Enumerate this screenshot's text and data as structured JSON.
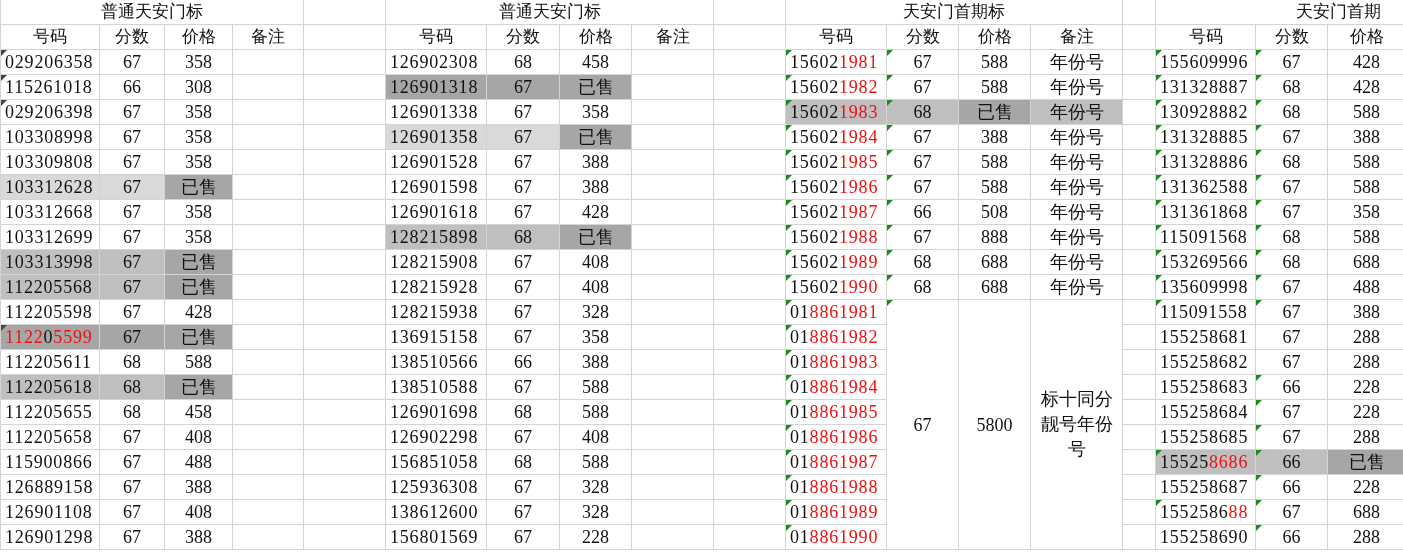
{
  "sections": [
    {
      "title": "普通天安门标",
      "columns": [
        "号码",
        "分数",
        "价格",
        "备注"
      ],
      "green_markers": false,
      "rows": [
        {
          "number": [
            {
              "text": "029206358",
              "red": false
            }
          ],
          "score": "67",
          "price": "358",
          "color": "#ffffff",
          "sold": false,
          "flag": true,
          "score_flag": false
        },
        {
          "number": [
            {
              "text": "115261018",
              "red": false
            }
          ],
          "score": "66",
          "price": "308",
          "color": "#ffffff",
          "sold": false,
          "flag": true,
          "score_flag": false
        },
        {
          "number": [
            {
              "text": "029206398",
              "red": false
            }
          ],
          "score": "67",
          "price": "358",
          "color": "#ffffff",
          "sold": false,
          "flag": true,
          "score_flag": false
        },
        {
          "number": [
            {
              "text": "103308998",
              "red": false
            }
          ],
          "score": "67",
          "price": "358",
          "color": "#ffffff",
          "sold": false,
          "flag": false,
          "score_flag": false
        },
        {
          "number": [
            {
              "text": "103309808",
              "red": false
            }
          ],
          "score": "67",
          "price": "358",
          "color": "#ffffff",
          "sold": false,
          "flag": false,
          "score_flag": false
        },
        {
          "number": [
            {
              "text": "103312628",
              "red": false
            }
          ],
          "score": "67",
          "price": "已售",
          "color": "#d9d9d9",
          "sold": true,
          "flag": false,
          "score_flag": false
        },
        {
          "number": [
            {
              "text": "103312668",
              "red": false
            }
          ],
          "score": "67",
          "price": "358",
          "color": "#ffffff",
          "sold": false,
          "flag": false,
          "score_flag": false
        },
        {
          "number": [
            {
              "text": "103312699",
              "red": false
            }
          ],
          "score": "67",
          "price": "358",
          "color": "#ffffff",
          "sold": false,
          "flag": false,
          "score_flag": false
        },
        {
          "number": [
            {
              "text": "103313998",
              "red": false
            }
          ],
          "score": "67",
          "price": "已售",
          "color": "#bfbfbf",
          "sold": true,
          "flag": false,
          "score_flag": false
        },
        {
          "number": [
            {
              "text": "112205568",
              "red": false
            }
          ],
          "score": "67",
          "price": "已售",
          "color": "#bfbfbf",
          "sold": true,
          "flag": false,
          "score_flag": false
        },
        {
          "number": [
            {
              "text": "112205598",
              "red": false
            }
          ],
          "score": "67",
          "price": "428",
          "color": "#ffffff",
          "sold": false,
          "flag": false,
          "score_flag": false
        },
        {
          "number": [
            {
              "text": "1122",
              "red": true
            },
            {
              "text": "0",
              "red": false
            },
            {
              "text": "5599",
              "red": true
            }
          ],
          "score": "67",
          "price": "已售",
          "color": "#a6a6a6",
          "sold": true,
          "flag": true,
          "score_flag": false
        },
        {
          "number": [
            {
              "text": "112205611",
              "red": false
            }
          ],
          "score": "68",
          "price": "588",
          "color": "#ffffff",
          "sold": false,
          "flag": false,
          "score_flag": false
        },
        {
          "number": [
            {
              "text": "112205618",
              "red": false
            }
          ],
          "score": "68",
          "price": "已售",
          "color": "#bfbfbf",
          "sold": true,
          "flag": false,
          "score_flag": false
        },
        {
          "number": [
            {
              "text": "112205655",
              "red": false
            }
          ],
          "score": "68",
          "price": "458",
          "color": "#ffffff",
          "sold": false,
          "flag": false,
          "score_flag": false
        },
        {
          "number": [
            {
              "text": "112205658",
              "red": false
            }
          ],
          "score": "67",
          "price": "408",
          "color": "#ffffff",
          "sold": false,
          "flag": false,
          "score_flag": false
        },
        {
          "number": [
            {
              "text": "115900866",
              "red": false
            }
          ],
          "score": "67",
          "price": "488",
          "color": "#ffffff",
          "sold": false,
          "flag": false,
          "score_flag": false
        },
        {
          "number": [
            {
              "text": "126889158",
              "red": false
            }
          ],
          "score": "67",
          "price": "388",
          "color": "#ffffff",
          "sold": false,
          "flag": false,
          "score_flag": false
        },
        {
          "number": [
            {
              "text": "126901108",
              "red": false
            }
          ],
          "score": "67",
          "price": "408",
          "color": "#ffffff",
          "sold": false,
          "flag": false,
          "score_flag": false
        },
        {
          "number": [
            {
              "text": "126901298",
              "red": false
            }
          ],
          "score": "67",
          "price": "388",
          "color": "#ffffff",
          "sold": false,
          "flag": false,
          "score_flag": false
        }
      ]
    },
    {
      "title": "普通天安门标",
      "columns": [
        "号码",
        "分数",
        "价格",
        "备注"
      ],
      "rows": [
        {
          "number": [
            {
              "text": "126902308",
              "red": false
            }
          ],
          "score": "68",
          "price": "458",
          "color": "#ffffff",
          "sold": false,
          "flag": false,
          "score_flag": false
        },
        {
          "number": [
            {
              "text": "126901318",
              "red": false
            }
          ],
          "score": "67",
          "price": "已售",
          "color": "#a6a6a6",
          "sold": true,
          "flag": false,
          "score_flag": false
        },
        {
          "number": [
            {
              "text": "126901338",
              "red": false
            }
          ],
          "score": "67",
          "price": "358",
          "color": "#ffffff",
          "sold": false,
          "flag": false,
          "score_flag": false
        },
        {
          "number": [
            {
              "text": "126901358",
              "red": false
            }
          ],
          "score": "67",
          "price": "已售",
          "color": "#d9d9d9",
          "sold": true,
          "flag": false,
          "score_flag": false
        },
        {
          "number": [
            {
              "text": "126901528",
              "red": false
            }
          ],
          "score": "67",
          "price": "388",
          "color": "#ffffff",
          "sold": false,
          "flag": false,
          "score_flag": false
        },
        {
          "number": [
            {
              "text": "126901598",
              "red": false
            }
          ],
          "score": "67",
          "price": "388",
          "color": "#ffffff",
          "sold": false,
          "flag": false,
          "score_flag": false
        },
        {
          "number": [
            {
              "text": "126901618",
              "red": false
            }
          ],
          "score": "67",
          "price": "428",
          "color": "#ffffff",
          "sold": false,
          "flag": false,
          "score_flag": false
        },
        {
          "number": [
            {
              "text": "128215898",
              "red": false
            }
          ],
          "score": "68",
          "price": "已售",
          "color": "#bfbfbf",
          "sold": true,
          "flag": false,
          "score_flag": false
        },
        {
          "number": [
            {
              "text": "128215908",
              "red": false
            }
          ],
          "score": "67",
          "price": "408",
          "color": "#ffffff",
          "sold": false,
          "flag": false,
          "score_flag": false
        },
        {
          "number": [
            {
              "text": "128215928",
              "red": false
            }
          ],
          "score": "67",
          "price": "408",
          "color": "#ffffff",
          "sold": false,
          "flag": false,
          "score_flag": false
        },
        {
          "number": [
            {
              "text": "128215938",
              "red": false
            }
          ],
          "score": "67",
          "price": "328",
          "color": "#ffffff",
          "sold": false,
          "flag": false,
          "score_flag": false
        },
        {
          "number": [
            {
              "text": "136915158",
              "red": false
            }
          ],
          "score": "67",
          "price": "358",
          "color": "#ffffff",
          "sold": false,
          "flag": false,
          "score_flag": false
        },
        {
          "number": [
            {
              "text": "138510566",
              "red": false
            }
          ],
          "score": "66",
          "price": "388",
          "color": "#ffffff",
          "sold": false,
          "flag": false,
          "score_flag": false
        },
        {
          "number": [
            {
              "text": "138510588",
              "red": false
            }
          ],
          "score": "67",
          "price": "588",
          "color": "#ffffff",
          "sold": false,
          "flag": false,
          "score_flag": false
        },
        {
          "number": [
            {
              "text": "126901698",
              "red": false
            }
          ],
          "score": "68",
          "price": "588",
          "color": "#ffffff",
          "sold": false,
          "flag": false,
          "score_flag": false
        },
        {
          "number": [
            {
              "text": "126902298",
              "red": false
            }
          ],
          "score": "67",
          "price": "408",
          "color": "#ffffff",
          "sold": false,
          "flag": false,
          "score_flag": false
        },
        {
          "number": [
            {
              "text": "156851058",
              "red": false
            }
          ],
          "score": "68",
          "price": "588",
          "color": "#ffffff",
          "sold": false,
          "flag": false,
          "score_flag": false
        },
        {
          "number": [
            {
              "text": "125936308",
              "red": false
            }
          ],
          "score": "67",
          "price": "328",
          "color": "#ffffff",
          "sold": false,
          "flag": false,
          "score_flag": false
        },
        {
          "number": [
            {
              "text": "138612600",
              "red": false
            }
          ],
          "score": "67",
          "price": "328",
          "color": "#ffffff",
          "sold": false,
          "flag": false,
          "score_flag": false
        },
        {
          "number": [
            {
              "text": "156801569",
              "red": false
            }
          ],
          "score": "67",
          "price": "228",
          "color": "#ffffff",
          "sold": false,
          "flag": false,
          "score_flag": false
        }
      ]
    },
    {
      "title": "天安门首期标",
      "columns": [
        "号码",
        "分数",
        "价格",
        "备注"
      ],
      "green_markers": true,
      "rows": [
        {
          "number": [
            {
              "text": "15602",
              "red": false
            },
            {
              "text": "1981",
              "red": true
            }
          ],
          "score": "67",
          "price": "588",
          "note": "年份号",
          "color": "#ffffff",
          "sold": false,
          "flag": true,
          "score_flag": true
        },
        {
          "number": [
            {
              "text": "15602",
              "red": false
            },
            {
              "text": "1982",
              "red": true
            }
          ],
          "score": "67",
          "price": "588",
          "note": "年份号",
          "color": "#ffffff",
          "sold": false,
          "flag": true,
          "score_flag": true
        },
        {
          "number": [
            {
              "text": "15602",
              "red": false
            },
            {
              "text": "1983",
              "red": true
            }
          ],
          "score": "68",
          "price": "已售",
          "note": "年份号",
          "color": "#bfbfbf",
          "sold": true,
          "flag": true,
          "score_flag": true
        },
        {
          "number": [
            {
              "text": "15602",
              "red": false
            },
            {
              "text": "1984",
              "red": true
            }
          ],
          "score": "67",
          "price": "388",
          "note": "年份号",
          "color": "#ffffff",
          "sold": false,
          "flag": true,
          "score_flag": true
        },
        {
          "number": [
            {
              "text": "15602",
              "red": false
            },
            {
              "text": "1985",
              "red": true
            }
          ],
          "score": "67",
          "price": "588",
          "note": "年份号",
          "color": "#ffffff",
          "sold": false,
          "flag": true,
          "score_flag": true
        },
        {
          "number": [
            {
              "text": "15602",
              "red": false
            },
            {
              "text": "1986",
              "red": true
            }
          ],
          "score": "67",
          "price": "588",
          "note": "年份号",
          "color": "#ffffff",
          "sold": false,
          "flag": true,
          "score_flag": true
        },
        {
          "number": [
            {
              "text": "15602",
              "red": false
            },
            {
              "text": "1987",
              "red": true
            }
          ],
          "score": "66",
          "price": "508",
          "note": "年份号",
          "color": "#ffffff",
          "sold": false,
          "flag": true,
          "score_flag": true
        },
        {
          "number": [
            {
              "text": "15602",
              "red": false
            },
            {
              "text": "1988",
              "red": true
            }
          ],
          "score": "67",
          "price": "888",
          "note": "年份号",
          "color": "#ffffff",
          "sold": false,
          "flag": true,
          "score_flag": true
        },
        {
          "number": [
            {
              "text": "15602",
              "red": false
            },
            {
              "text": "1989",
              "red": true
            }
          ],
          "score": "68",
          "price": "688",
          "note": "年份号",
          "color": "#ffffff",
          "sold": false,
          "flag": true,
          "score_flag": true
        },
        {
          "number": [
            {
              "text": "15602",
              "red": false
            },
            {
              "text": "1990",
              "red": true
            }
          ],
          "score": "68",
          "price": "688",
          "note": "年份号",
          "color": "#ffffff",
          "sold": false,
          "flag": true,
          "score_flag": true
        }
      ],
      "merged": {
        "numbers": [
          {
            "number": [
              {
                "text": "01",
                "red": false
              },
              {
                "text": "8861981",
                "red": true
              }
            ],
            "flag": true
          },
          {
            "number": [
              {
                "text": "01",
                "red": false
              },
              {
                "text": "8861982",
                "red": true
              }
            ],
            "flag": true
          },
          {
            "number": [
              {
                "text": "01",
                "red": false
              },
              {
                "text": "8861983",
                "red": true
              }
            ],
            "flag": true
          },
          {
            "number": [
              {
                "text": "01",
                "red": false
              },
              {
                "text": "8861984",
                "red": true
              }
            ],
            "flag": true
          },
          {
            "number": [
              {
                "text": "01",
                "red": false
              },
              {
                "text": "8861985",
                "red": true
              }
            ],
            "flag": true
          },
          {
            "number": [
              {
                "text": "01",
                "red": false
              },
              {
                "text": "8861986",
                "red": true
              }
            ],
            "flag": true
          },
          {
            "number": [
              {
                "text": "01",
                "red": false
              },
              {
                "text": "8861987",
                "red": true
              }
            ],
            "flag": true
          },
          {
            "number": [
              {
                "text": "01",
                "red": false
              },
              {
                "text": "8861988",
                "red": true
              }
            ],
            "flag": true
          },
          {
            "number": [
              {
                "text": "01",
                "red": false
              },
              {
                "text": "8861989",
                "red": true
              }
            ],
            "flag": true
          },
          {
            "number": [
              {
                "text": "01",
                "red": false
              },
              {
                "text": "8861990",
                "red": true
              }
            ],
            "flag": true
          }
        ],
        "score": "67",
        "score_flag": true,
        "price": "5800",
        "note": "标十同分靓号年份号"
      }
    },
    {
      "title": "天安门首期",
      "columns": [
        "号码",
        "分数",
        "价格"
      ],
      "green_markers": true,
      "rows": [
        {
          "number": [
            {
              "text": "155609996",
              "red": false
            }
          ],
          "score": "67",
          "price": "428",
          "color": "#ffffff",
          "sold": false,
          "flag": true,
          "score_flag": true
        },
        {
          "number": [
            {
              "text": "131328887",
              "red": false
            }
          ],
          "score": "68",
          "price": "428",
          "color": "#ffffff",
          "sold": false,
          "flag": true,
          "score_flag": true
        },
        {
          "number": [
            {
              "text": "130928882",
              "red": false
            }
          ],
          "score": "68",
          "price": "588",
          "color": "#ffffff",
          "sold": false,
          "flag": true,
          "score_flag": true
        },
        {
          "number": [
            {
              "text": "131328885",
              "red": false
            }
          ],
          "score": "67",
          "price": "388",
          "color": "#ffffff",
          "sold": false,
          "flag": true,
          "score_flag": true
        },
        {
          "number": [
            {
              "text": "131328886",
              "red": false
            }
          ],
          "score": "68",
          "price": "588",
          "color": "#ffffff",
          "sold": false,
          "flag": true,
          "score_flag": true
        },
        {
          "number": [
            {
              "text": "131362588",
              "red": false
            }
          ],
          "score": "67",
          "price": "588",
          "color": "#ffffff",
          "sold": false,
          "flag": true,
          "score_flag": true
        },
        {
          "number": [
            {
              "text": "131361868",
              "red": false
            }
          ],
          "score": "67",
          "price": "358",
          "color": "#ffffff",
          "sold": false,
          "flag": true,
          "score_flag": true
        },
        {
          "number": [
            {
              "text": "115091568",
              "red": false
            }
          ],
          "score": "68",
          "price": "588",
          "color": "#ffffff",
          "sold": false,
          "flag": true,
          "score_flag": true
        },
        {
          "number": [
            {
              "text": "153269566",
              "red": false
            }
          ],
          "score": "68",
          "price": "688",
          "color": "#ffffff",
          "sold": false,
          "flag": true,
          "score_flag": true
        },
        {
          "number": [
            {
              "text": "135609998",
              "red": false
            }
          ],
          "score": "67",
          "price": "488",
          "color": "#ffffff",
          "sold": false,
          "flag": true,
          "score_flag": true
        },
        {
          "number": [
            {
              "text": "115091558",
              "red": false
            }
          ],
          "score": "67",
          "price": "388",
          "color": "#ffffff",
          "sold": false,
          "flag": true,
          "score_flag": true
        },
        {
          "number": [
            {
              "text": "155258681",
              "red": false
            }
          ],
          "score": "67",
          "price": "288",
          "color": "#ffffff",
          "sold": false,
          "flag": false,
          "score_flag": false
        },
        {
          "number": [
            {
              "text": "155258682",
              "red": false
            }
          ],
          "score": "67",
          "price": "288",
          "color": "#ffffff",
          "sold": false,
          "flag": false,
          "score_flag": false
        },
        {
          "number": [
            {
              "text": "155258683",
              "red": false
            }
          ],
          "score": "66",
          "price": "228",
          "color": "#ffffff",
          "sold": false,
          "flag": false,
          "score_flag": true
        },
        {
          "number": [
            {
              "text": "155258684",
              "red": false
            }
          ],
          "score": "67",
          "price": "228",
          "color": "#ffffff",
          "sold": false,
          "flag": false,
          "score_flag": true
        },
        {
          "number": [
            {
              "text": "155258685",
              "red": false
            }
          ],
          "score": "67",
          "price": "288",
          "color": "#ffffff",
          "sold": false,
          "flag": false,
          "score_flag": true
        },
        {
          "number": [
            {
              "text": "15525",
              "red": false
            },
            {
              "text": "8686",
              "red": true
            }
          ],
          "score": "66",
          "price": "已售",
          "color": "#bfbfbf",
          "sold": true,
          "flag": true,
          "score_flag": true
        },
        {
          "number": [
            {
              "text": "155258687",
              "red": false
            }
          ],
          "score": "66",
          "price": "228",
          "color": "#ffffff",
          "sold": false,
          "flag": false,
          "score_flag": true
        },
        {
          "number": [
            {
              "text": "1552586",
              "red": false
            },
            {
              "text": "88",
              "red": true
            }
          ],
          "score": "67",
          "price": "688",
          "color": "#ffffff",
          "sold": false,
          "flag": true,
          "score_flag": true
        },
        {
          "number": [
            {
              "text": "155258690",
              "red": false
            }
          ],
          "score": "66",
          "price": "288",
          "color": "#ffffff",
          "sold": false,
          "flag": false,
          "score_flag": true
        }
      ]
    }
  ]
}
